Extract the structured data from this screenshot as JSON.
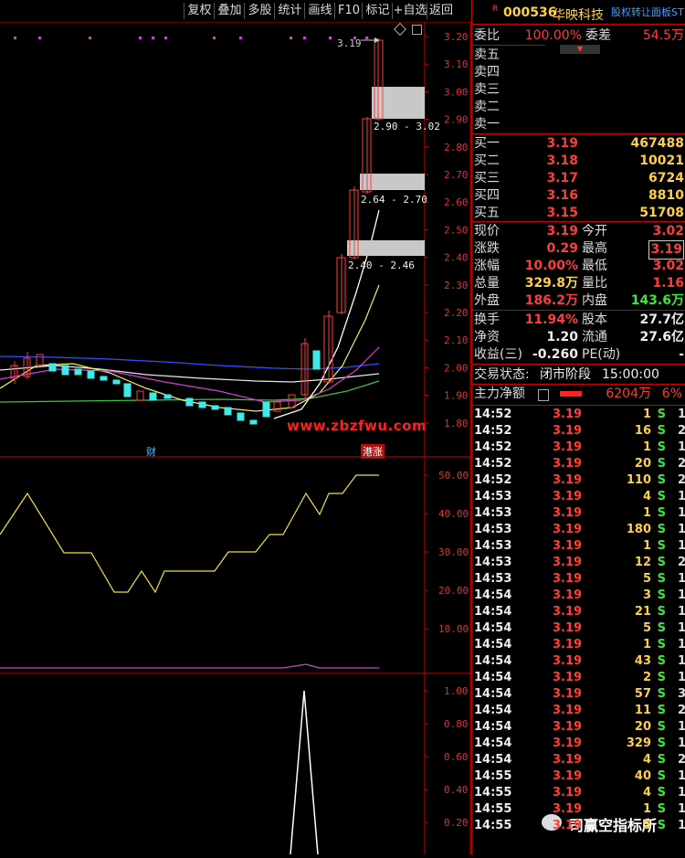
{
  "toolbar": {
    "buttons": [
      "复权",
      "叠加",
      "多股",
      "统计",
      "画线",
      "F10",
      "标记",
      "+自选",
      "返回"
    ]
  },
  "price_axis": [
    "3.20",
    "3.10",
    "3.00",
    "2.90",
    "2.80",
    "2.70",
    "2.60",
    "2.50",
    "2.40",
    "2.30",
    "2.20",
    "2.10",
    "2.00",
    "1.90",
    "1.80"
  ],
  "annotations": {
    "high_label": "3.19",
    "gap1": "2.90 - 3.02",
    "gap2": "2.64 - 2.70",
    "gap3": "2.40 - 2.46",
    "watermark": "www.zbzfwu.com",
    "marker_cai": "财",
    "marker_gangzhang": "港涨"
  },
  "indicator1_axis": [
    "50.00",
    "40.00",
    "30.00",
    "20.00",
    "10.00"
  ],
  "indicator2_axis": [
    "1.00",
    "0.80",
    "0.60",
    "0.40",
    "0.20"
  ],
  "header": {
    "r_badge": "R",
    "code": "000536",
    "name": "华映科技",
    "right_tag": "股权转让面板ST"
  },
  "weibi": {
    "label1": "委比",
    "value1": "100.00%",
    "label2": "委差",
    "value2": "54.5万"
  },
  "sell": [
    {
      "label": "卖五"
    },
    {
      "label": "卖四"
    },
    {
      "label": "卖三"
    },
    {
      "label": "卖二"
    },
    {
      "label": "卖一"
    }
  ],
  "buy": [
    {
      "label": "买一",
      "price": "3.19",
      "vol": "467488"
    },
    {
      "label": "买二",
      "price": "3.18",
      "vol": "10021"
    },
    {
      "label": "买三",
      "price": "3.17",
      "vol": "6724"
    },
    {
      "label": "买四",
      "price": "3.16",
      "vol": "8810"
    },
    {
      "label": "买五",
      "price": "3.15",
      "vol": "51708"
    }
  ],
  "quote": [
    {
      "l1": "现价",
      "v1": "3.19",
      "l2": "今开",
      "v2": "3.02"
    },
    {
      "l1": "涨跌",
      "v1": "0.29",
      "l2": "最高",
      "v2": "3.19"
    },
    {
      "l1": "涨幅",
      "v1": "10.00%",
      "l2": "最低",
      "v2": "3.02"
    },
    {
      "l1": "总量",
      "v1": "329.8万",
      "l2": "量比",
      "v2": "1.16"
    },
    {
      "l1": "外盘",
      "v1": "186.2万",
      "l2": "内盘",
      "v2": "143.6万"
    }
  ],
  "fund": [
    {
      "l1": "换手",
      "v1": "11.94%",
      "l2": "股本",
      "v2": "27.7亿"
    },
    {
      "l1": "净资",
      "v1": "1.20",
      "l2": "流通",
      "v2": "27.6亿"
    },
    {
      "l1": "收益(三)",
      "v1": "-0.260",
      "l2": "PE(动)",
      "v2": "-"
    }
  ],
  "status": {
    "label": "交易状态:",
    "value": "闭市阶段",
    "time": "15:00:00"
  },
  "netflow": {
    "label": "主力净额",
    "value": "6204万",
    "pct": "6%"
  },
  "ticks": [
    [
      "14:52",
      "3.19",
      "1",
      "S",
      "1"
    ],
    [
      "14:52",
      "3.19",
      "16",
      "S",
      "2"
    ],
    [
      "14:52",
      "3.19",
      "1",
      "S",
      "1"
    ],
    [
      "14:52",
      "3.19",
      "20",
      "S",
      "2"
    ],
    [
      "14:52",
      "3.19",
      "110",
      "S",
      "2"
    ],
    [
      "14:53",
      "3.19",
      "4",
      "S",
      "1"
    ],
    [
      "14:53",
      "3.19",
      "1",
      "S",
      "1"
    ],
    [
      "14:53",
      "3.19",
      "180",
      "S",
      "1"
    ],
    [
      "14:53",
      "3.19",
      "1",
      "S",
      "1"
    ],
    [
      "14:53",
      "3.19",
      "12",
      "S",
      "2"
    ],
    [
      "14:53",
      "3.19",
      "5",
      "S",
      "1"
    ],
    [
      "14:54",
      "3.19",
      "3",
      "S",
      "1"
    ],
    [
      "14:54",
      "3.19",
      "21",
      "S",
      "1"
    ],
    [
      "14:54",
      "3.19",
      "5",
      "S",
      "1"
    ],
    [
      "14:54",
      "3.19",
      "1",
      "S",
      "1"
    ],
    [
      "14:54",
      "3.19",
      "43",
      "S",
      "1"
    ],
    [
      "14:54",
      "3.19",
      "2",
      "S",
      "1"
    ],
    [
      "14:54",
      "3.19",
      "57",
      "S",
      "3"
    ],
    [
      "14:54",
      "3.19",
      "11",
      "S",
      "2"
    ],
    [
      "14:54",
      "3.19",
      "20",
      "S",
      "1"
    ],
    [
      "14:54",
      "3.19",
      "329",
      "S",
      "1"
    ],
    [
      "14:54",
      "3.19",
      "4",
      "S",
      "2"
    ],
    [
      "14:55",
      "3.19",
      "40",
      "S",
      "1"
    ],
    [
      "14:55",
      "3.19",
      "4",
      "S",
      "1"
    ],
    [
      "14:55",
      "3.19",
      "1",
      "S",
      "1"
    ],
    [
      "14:55",
      "3.19",
      "5",
      "S",
      "1"
    ]
  ],
  "overlay": {
    "brand": "司赢空指标所"
  },
  "colors": {
    "up": "#ff3c3c",
    "down": "#39e639",
    "vol": "#ffd040",
    "frame": "#c00000"
  }
}
